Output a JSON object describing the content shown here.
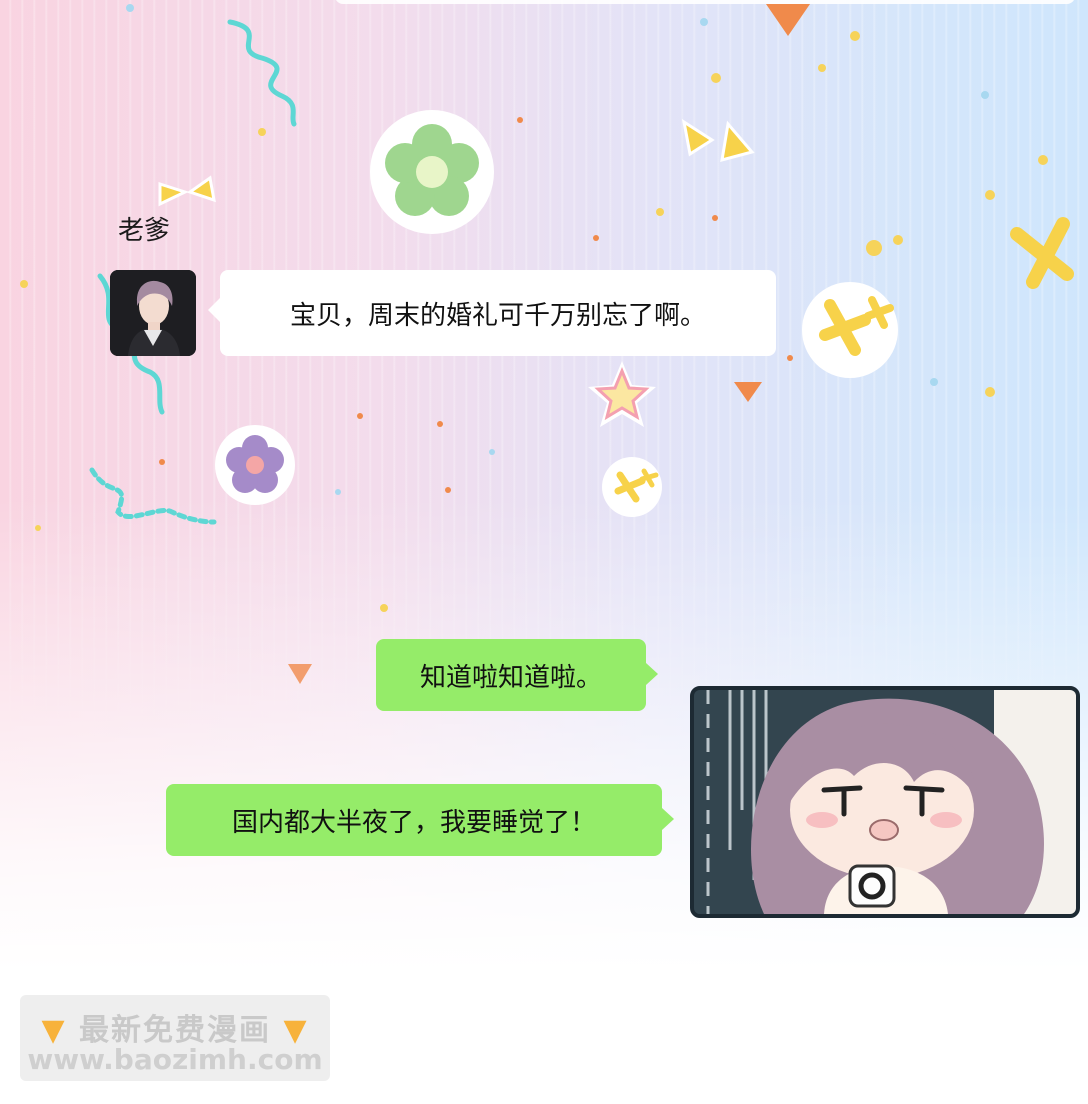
{
  "chat": {
    "incoming": {
      "sender_name": "老爹",
      "message": "宝贝，周末的婚礼可千万别忘了啊。"
    },
    "outgoing": [
      {
        "message": "知道啦知道啦。"
      },
      {
        "message": "国内都大半夜了，我要睡觉了！"
      }
    ]
  },
  "watermark": {
    "line1": "最新免费漫画",
    "line2": "www.baozimh.com"
  },
  "colors": {
    "outgoing_bubble": "#95ec69",
    "incoming_bubble": "#ffffff",
    "panel_border": "#1d2a33"
  },
  "icons": {
    "avatar": "man-portrait-avatar",
    "reaction_panel": "girl-chibi-illustration",
    "watermark_finger": "pointing-down-hand-icon"
  }
}
